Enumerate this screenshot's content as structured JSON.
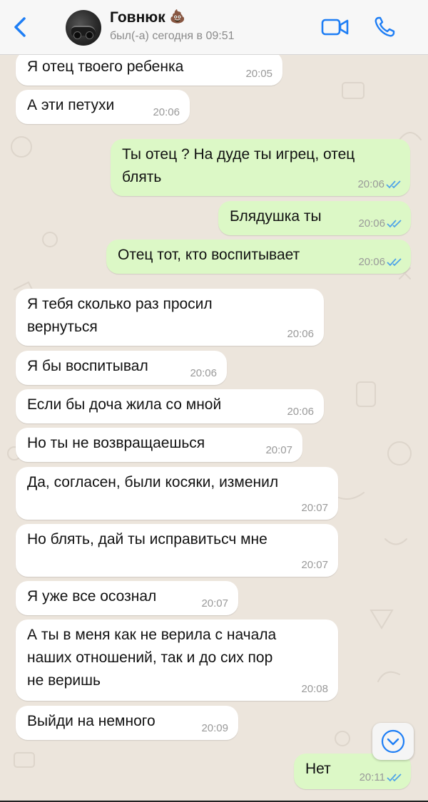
{
  "header": {
    "contact_name": "Говнюк",
    "contact_emoji": "💩",
    "status": "был(-а) сегодня в 09:51"
  },
  "messages": [
    {
      "dir": "in",
      "text": "Я отец твоего ребенка",
      "time": "20:05"
    },
    {
      "dir": "in",
      "text": "А эти петухи",
      "time": "20:06"
    },
    {
      "dir": "out",
      "text": "Ты отец ? На дуде ты игрец, отец\nблять",
      "time": "20:06",
      "read": true
    },
    {
      "dir": "out",
      "text": "Блядушка ты",
      "time": "20:06",
      "read": true
    },
    {
      "dir": "out",
      "text": "Отец тот, кто воспитывает",
      "time": "20:06",
      "read": true
    },
    {
      "dir": "in",
      "text": "Я тебя сколько раз просил\nвернуться",
      "time": "20:06"
    },
    {
      "dir": "in",
      "text": "Я бы воспитывал",
      "time": "20:06"
    },
    {
      "dir": "in",
      "text": "Если бы доча жила со мной",
      "time": "20:06"
    },
    {
      "dir": "in",
      "text": "Но ты не возвращаешься",
      "time": "20:07"
    },
    {
      "dir": "in",
      "text": "Да, согласен, были косяки, изменил",
      "time": "20:07"
    },
    {
      "dir": "in",
      "text": "Но блять, дай ты исправитьсч мне",
      "time": "20:07"
    },
    {
      "dir": "in",
      "text": "Я уже все осознал",
      "time": "20:07"
    },
    {
      "dir": "in",
      "text": "А ты в меня как не верила с начала\nнаших отношений, так и до сих пор\nне веришь",
      "time": "20:08"
    },
    {
      "dir": "in",
      "text": "Выйди на немного",
      "time": "20:09"
    },
    {
      "dir": "out",
      "text": "Нет",
      "time": "20:11",
      "read": true
    }
  ],
  "colors": {
    "accent": "#1e7ef5",
    "incoming_bubble": "#ffffff",
    "outgoing_bubble": "#dcf8c6",
    "read_ticks": "#4fa3e8",
    "background": "#ece5dc"
  }
}
